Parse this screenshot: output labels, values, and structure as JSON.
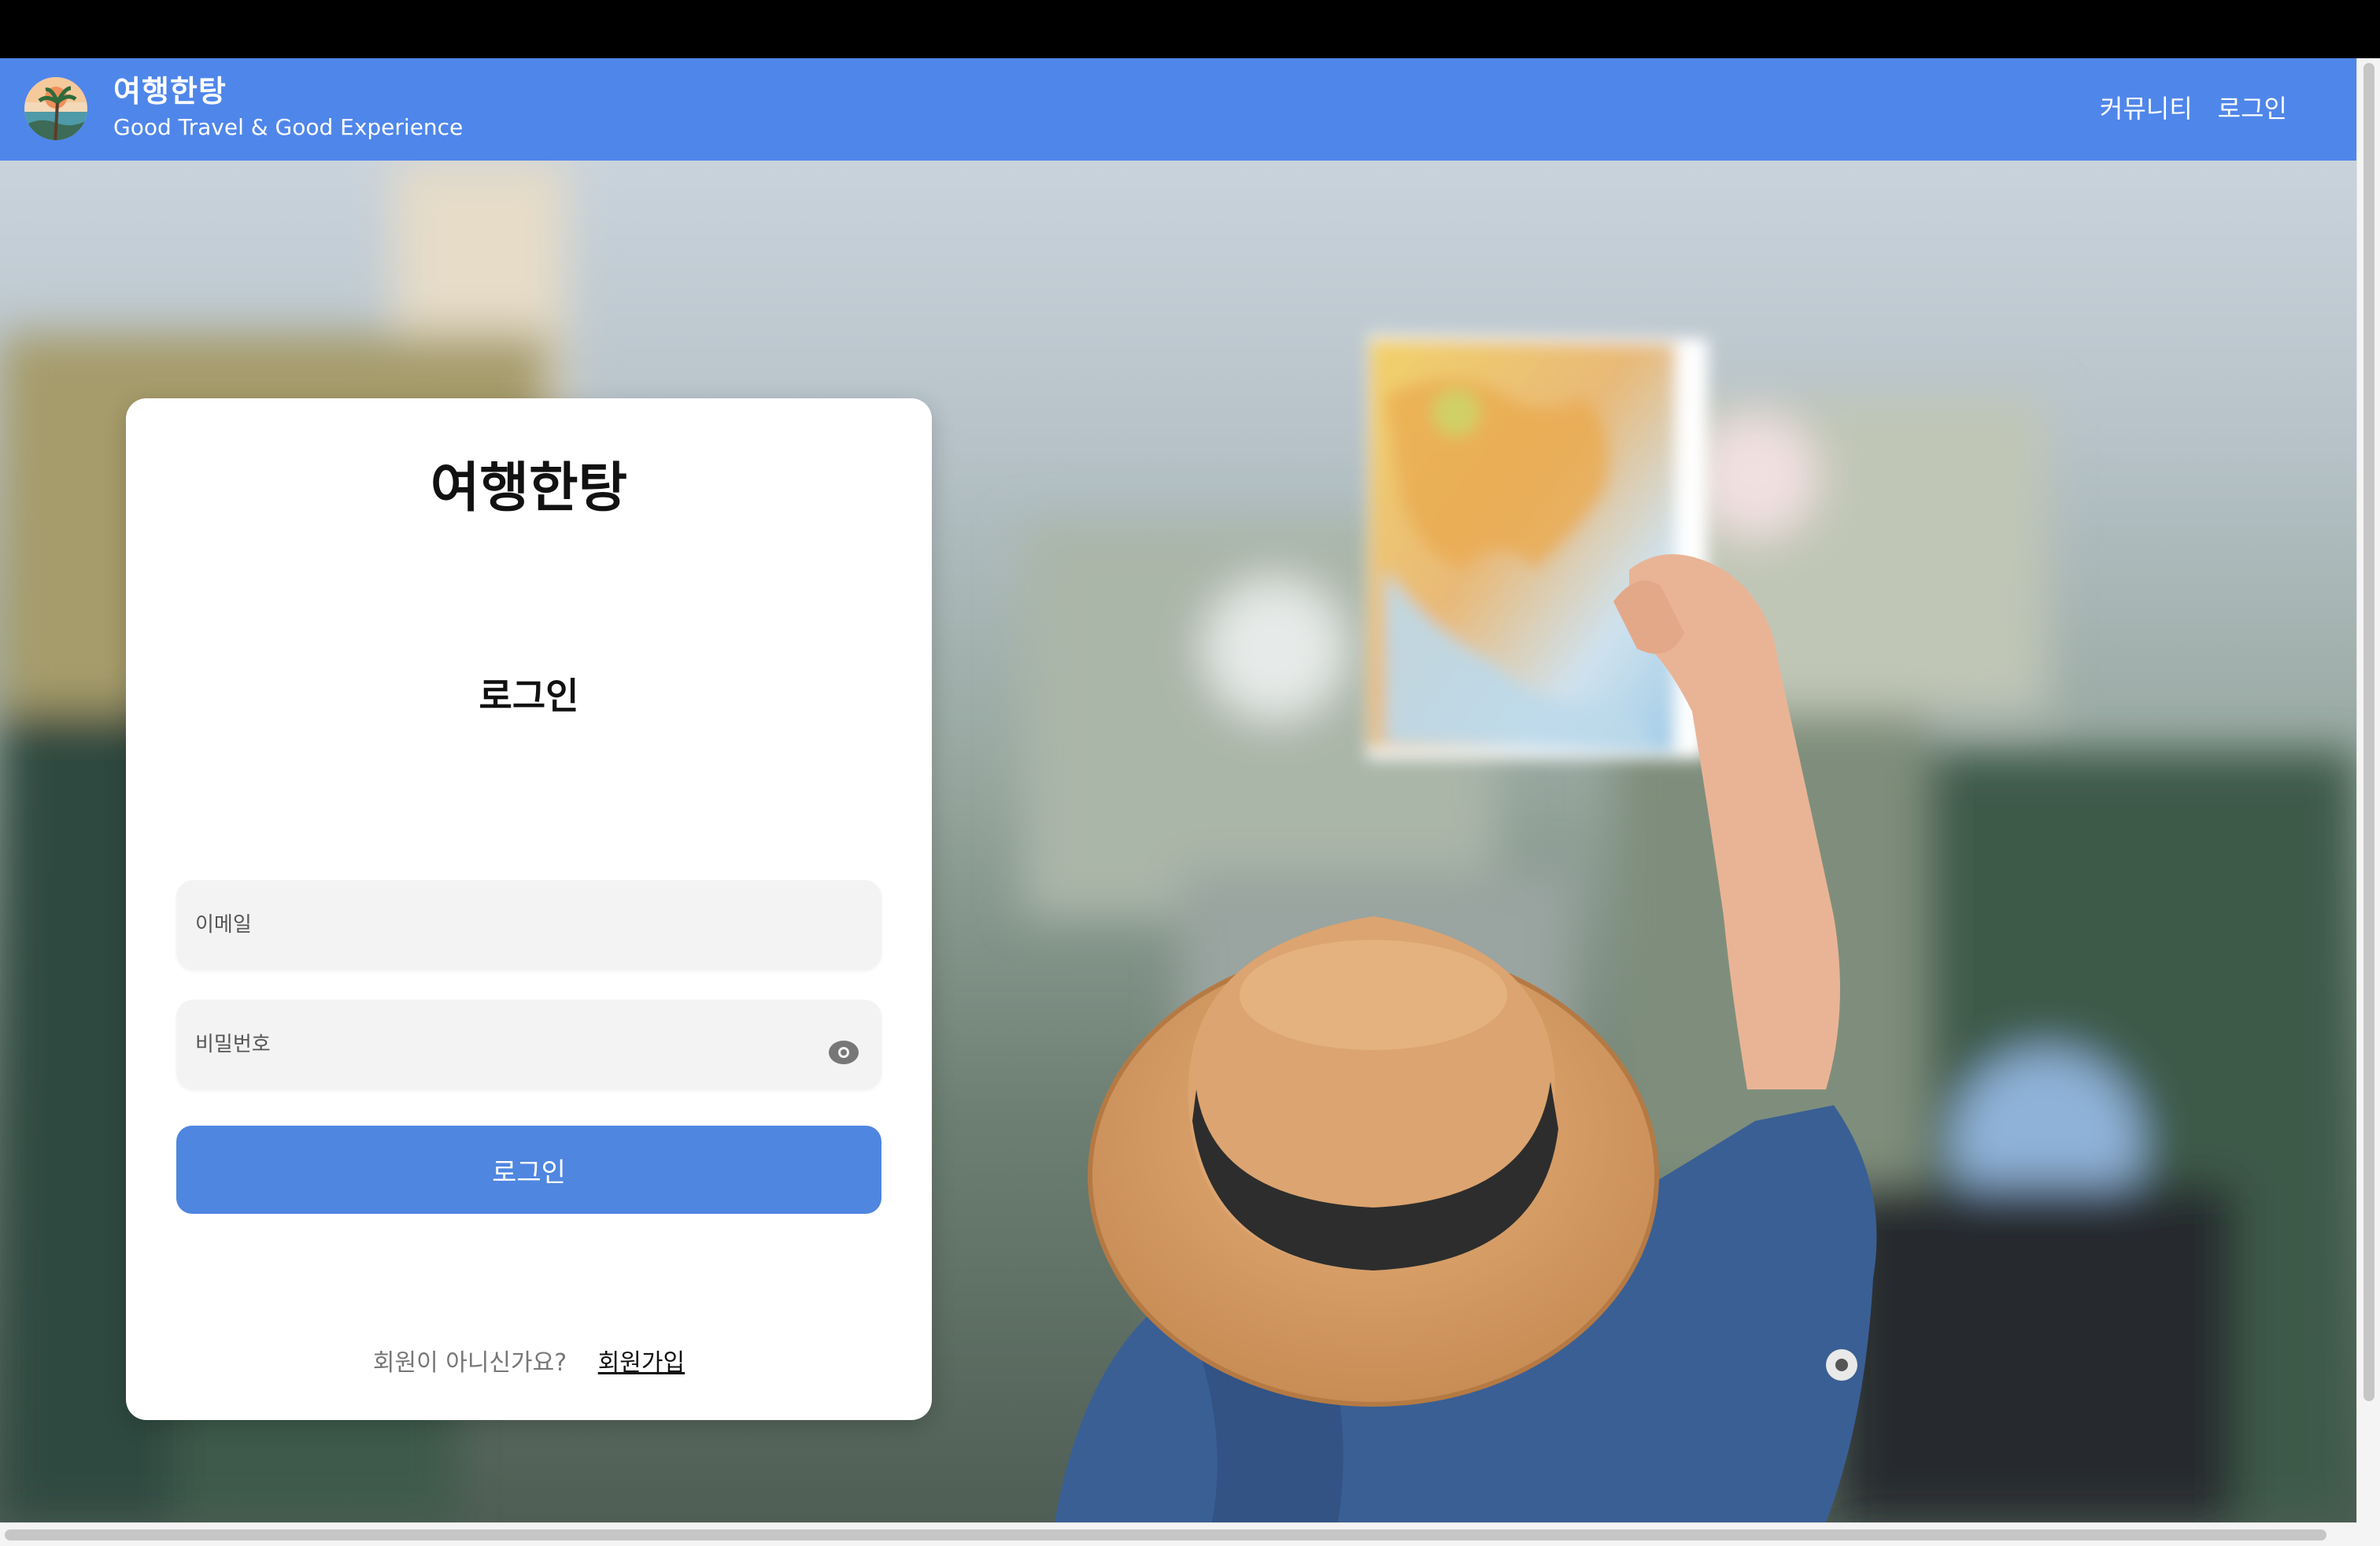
{
  "header": {
    "brand_title": "여행한탕",
    "brand_subtitle": "Good Travel & Good Experience",
    "nav": [
      {
        "label": "커뮤니티"
      },
      {
        "label": "로그인"
      }
    ]
  },
  "login_card": {
    "title": "여행한탕",
    "subtitle": "로그인",
    "email_placeholder": "이메일",
    "password_placeholder": "비밀번호",
    "submit_label": "로그인",
    "signup_question": "회원이 아니신가요?",
    "signup_link": "회원가입"
  },
  "icons": {
    "logo": "palm-tree-sunset-logo",
    "password_toggle": "eye-icon"
  },
  "colors": {
    "header_bg": "#4f86ea",
    "button_bg": "#4f86e0",
    "field_bg": "#f3f3f3",
    "hat": "#d9a270",
    "jacket": "#3a5f94"
  }
}
